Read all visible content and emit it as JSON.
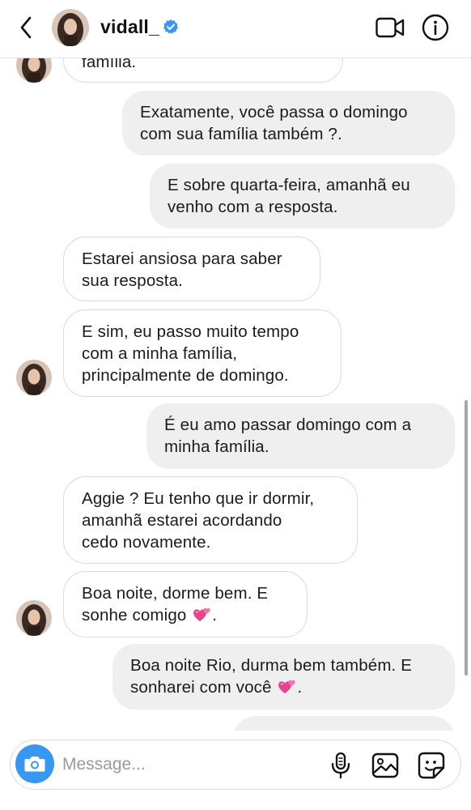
{
  "header": {
    "username": "vidall_",
    "verified": true,
    "icons": [
      "back-chevron-icon",
      "verified-badge-icon",
      "video-call-icon",
      "info-icon"
    ]
  },
  "messages": [
    {
      "side": "in",
      "text": "família."
    },
    {
      "side": "out",
      "text": "Exatamente, você passa o domingo com sua família também ?."
    },
    {
      "side": "out",
      "text": "E sobre quarta-feira, amanhã eu venho com a resposta."
    },
    {
      "side": "in",
      "text": "Estarei ansiosa para saber sua resposta."
    },
    {
      "side": "in",
      "text": "E sim, eu passo muito tempo com a minha família, principalmente de domingo."
    },
    {
      "side": "out",
      "text": "É eu amo passar domingo com a minha família."
    },
    {
      "side": "in",
      "text": "Aggie ? Eu tenho que ir dormir, amanhã estarei acordando cedo novamente."
    },
    {
      "side": "in",
      "text": "Boa noite, dorme bem. E sonhe comigo",
      "emoji": "two-hearts"
    },
    {
      "side": "out",
      "text": "Boa noite Rio, durma bem também. E sonharei com você",
      "emoji": "two-hearts"
    }
  ],
  "lines": {
    "m0": [
      "família."
    ],
    "m1": [
      "Exatamente, você passa o domingo",
      "com sua família também ?."
    ],
    "m2": [
      "E sobre quarta-feira, amanhã eu",
      "venho com a resposta."
    ],
    "m3": [
      "Estarei ansiosa para saber",
      "sua resposta."
    ],
    "m4": [
      "E sim, eu passo muito tempo",
      "com a minha família,",
      "principalmente de domingo."
    ],
    "m5": [
      "É eu amo passar domingo com a",
      "minha família."
    ],
    "m6": [
      "Aggie ? Eu tenho que ir dormir,",
      "amanhã estarei acordando",
      "cedo novamente."
    ],
    "m7": [
      "Boa noite, dorme bem. E",
      "sonhe comigo"
    ],
    "m8": [
      "Boa noite Rio, durma bem também. E",
      "sonharei com você"
    ]
  },
  "emoji_suffix": ".",
  "composer": {
    "placeholder": "Message...",
    "icons": [
      "camera-icon",
      "microphone-icon",
      "gallery-icon",
      "sticker-icon"
    ]
  },
  "colors": {
    "accent": "#3897f0",
    "verified": "#3897f0",
    "incoming_bubble_border": "#dbdbdb",
    "outgoing_bubble_bg": "#efefef",
    "heart": "#e8458b"
  }
}
